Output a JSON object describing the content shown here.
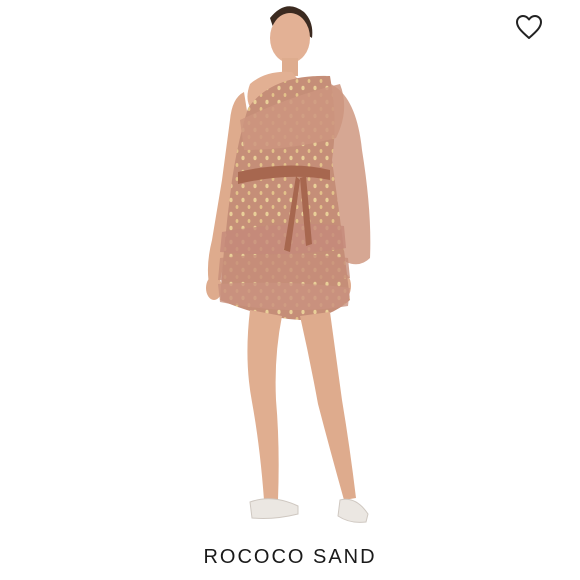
{
  "product": {
    "name": "ROCOCO SAND",
    "icon": "heart-outline-icon",
    "dress_color": "#c8907a",
    "accent_color": "#e6c48a"
  }
}
